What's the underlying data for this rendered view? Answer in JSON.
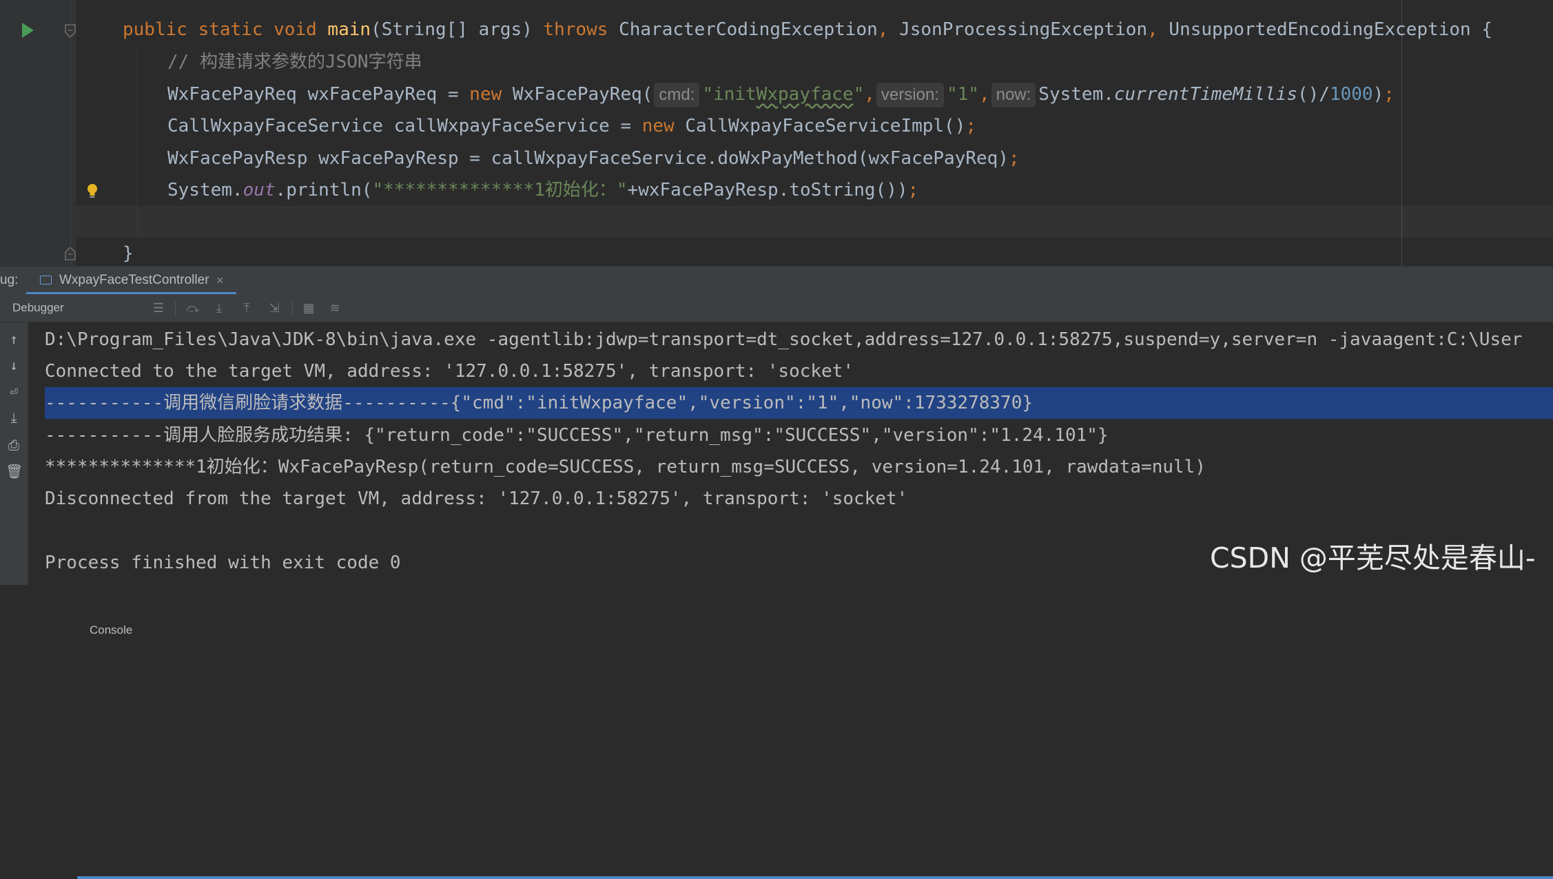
{
  "editor": {
    "lines": [
      {
        "kw1": "public static void ",
        "fn": "main",
        "sig": "(String[] args) ",
        "kw2": "throws",
        "t1": " CharacterCodingException",
        "c1": ",",
        "t2": " JsonProcessingException",
        "c2": ",",
        "t3": " UnsupportedEncodingException {"
      },
      {
        "comment": "// 构建请求参数的JSON字符串"
      },
      {
        "t1": "WxFacePayReq wxFacePayReq = ",
        "kw1": "new",
        "t2": " WxFacePayReq(",
        "hint1": "cmd:",
        "s1a": "\"init",
        "s1b": "Wxpayface",
        "s1c": "\"",
        "c1": ",",
        "hint2": "version:",
        "s2": "\"1\"",
        "c2": ",",
        "hint3": "now:",
        "t3": "System.",
        "m": "currentTimeMillis",
        "t4": "()/",
        "n": "1000",
        "t5": ")",
        "semi": ";"
      },
      {
        "t1": "CallWxpayFaceService callWxpayFaceService = ",
        "kw1": "new",
        "t2": " CallWxpayFaceServiceImpl()",
        "semi": ";"
      },
      {
        "t1": "WxFacePayResp wxFacePayResp = callWxpayFaceService.doWxPayMethod(wxFacePayReq)",
        "semi": ";"
      },
      {
        "t1": "System.",
        "field": "out",
        "t2": ".println(",
        "s1": "\"**************1初始化：\"",
        "t3": "+wxFacePayResp.toString())",
        "semi": ";"
      },
      {
        "t1": "}"
      }
    ]
  },
  "debug_panel": {
    "prefix": "ug:",
    "session_tab": "WxpayFaceTestController",
    "close_glyph": "×",
    "tabs": [
      "Debugger",
      "Console"
    ],
    "active_tab": "Console"
  },
  "console": {
    "lines": [
      "D:\\Program_Files\\Java\\JDK-8\\bin\\java.exe -agentlib:jdwp=transport=dt_socket,address=127.0.0.1:58275,suspend=y,server=n -javaagent:C:\\User",
      "Connected to the target VM, address: '127.0.0.1:58275', transport: 'socket'",
      "-----------调用微信刷脸请求数据----------{\"cmd\":\"initWxpayface\",\"version\":\"1\",\"now\":1733278370}",
      "-----------调用人脸服务成功结果: {\"return_code\":\"SUCCESS\",\"return_msg\":\"SUCCESS\",\"version\":\"1.24.101\"}",
      "**************1初始化：WxFacePayResp(return_code=SUCCESS, return_msg=SUCCESS, version=1.24.101, rawdata=null)",
      "Disconnected from the target VM, address: '127.0.0.1:58275', transport: 'socket'",
      "",
      "Process finished with exit code 0"
    ],
    "selected_line_index": 2
  },
  "watermark": "CSDN @平芜尽处是春山-",
  "colors": {
    "editor_bg": "#2b2b2b",
    "keyword": "#cc7832",
    "method": "#ffc66d",
    "string": "#6a8759",
    "number": "#6897bb",
    "selection": "#214283",
    "tab_accent": "#4a88c7",
    "run_icon": "#499c54"
  }
}
